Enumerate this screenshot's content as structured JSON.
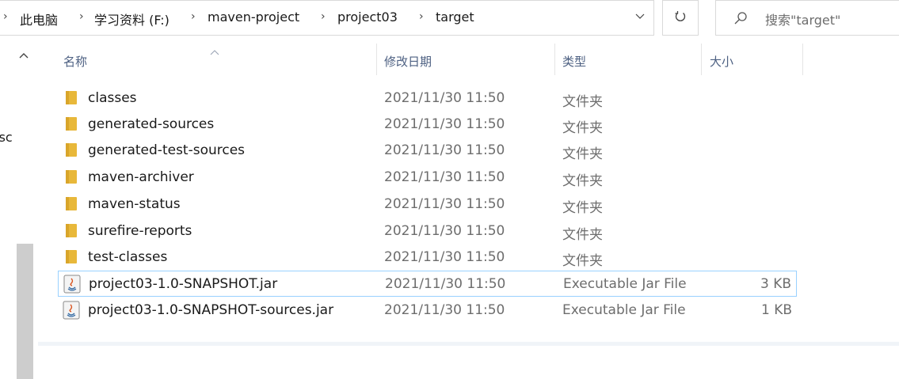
{
  "address": {
    "breadcrumbs": [
      "此电脑",
      "学习资料 (F:)",
      "maven-project",
      "project03",
      "target"
    ]
  },
  "search": {
    "placeholder": "搜索\"target\""
  },
  "nav": {
    "clipped_label": "rsc"
  },
  "columns": {
    "name": "名称",
    "date": "修改日期",
    "type": "类型",
    "size": "大小"
  },
  "files": [
    {
      "name": "classes",
      "date": "2021/11/30 11:50",
      "type": "文件夹",
      "size": "",
      "kind": "folder-icon"
    },
    {
      "name": "generated-sources",
      "date": "2021/11/30 11:50",
      "type": "文件夹",
      "size": "",
      "kind": "folder-icon"
    },
    {
      "name": "generated-test-sources",
      "date": "2021/11/30 11:50",
      "type": "文件夹",
      "size": "",
      "kind": "folder-icon"
    },
    {
      "name": "maven-archiver",
      "date": "2021/11/30 11:50",
      "type": "文件夹",
      "size": "",
      "kind": "folder-icon"
    },
    {
      "name": "maven-status",
      "date": "2021/11/30 11:50",
      "type": "文件夹",
      "size": "",
      "kind": "folder-icon"
    },
    {
      "name": "surefire-reports",
      "date": "2021/11/30 11:50",
      "type": "文件夹",
      "size": "",
      "kind": "folder-icon"
    },
    {
      "name": "test-classes",
      "date": "2021/11/30 11:50",
      "type": "文件夹",
      "size": "",
      "kind": "folder-icon"
    },
    {
      "name": "project03-1.0-SNAPSHOT.jar",
      "date": "2021/11/30 11:50",
      "type": "Executable Jar File",
      "size": "3 KB",
      "kind": "jar-file-icon"
    },
    {
      "name": "project03-1.0-SNAPSHOT-sources.jar",
      "date": "2021/11/30 11:50",
      "type": "Executable Jar File",
      "size": "1 KB",
      "kind": "jar-file-icon"
    }
  ],
  "colors": {
    "folder": "#e8b83a",
    "selection_border": "#99d1ff",
    "header_text": "#4d6082"
  }
}
